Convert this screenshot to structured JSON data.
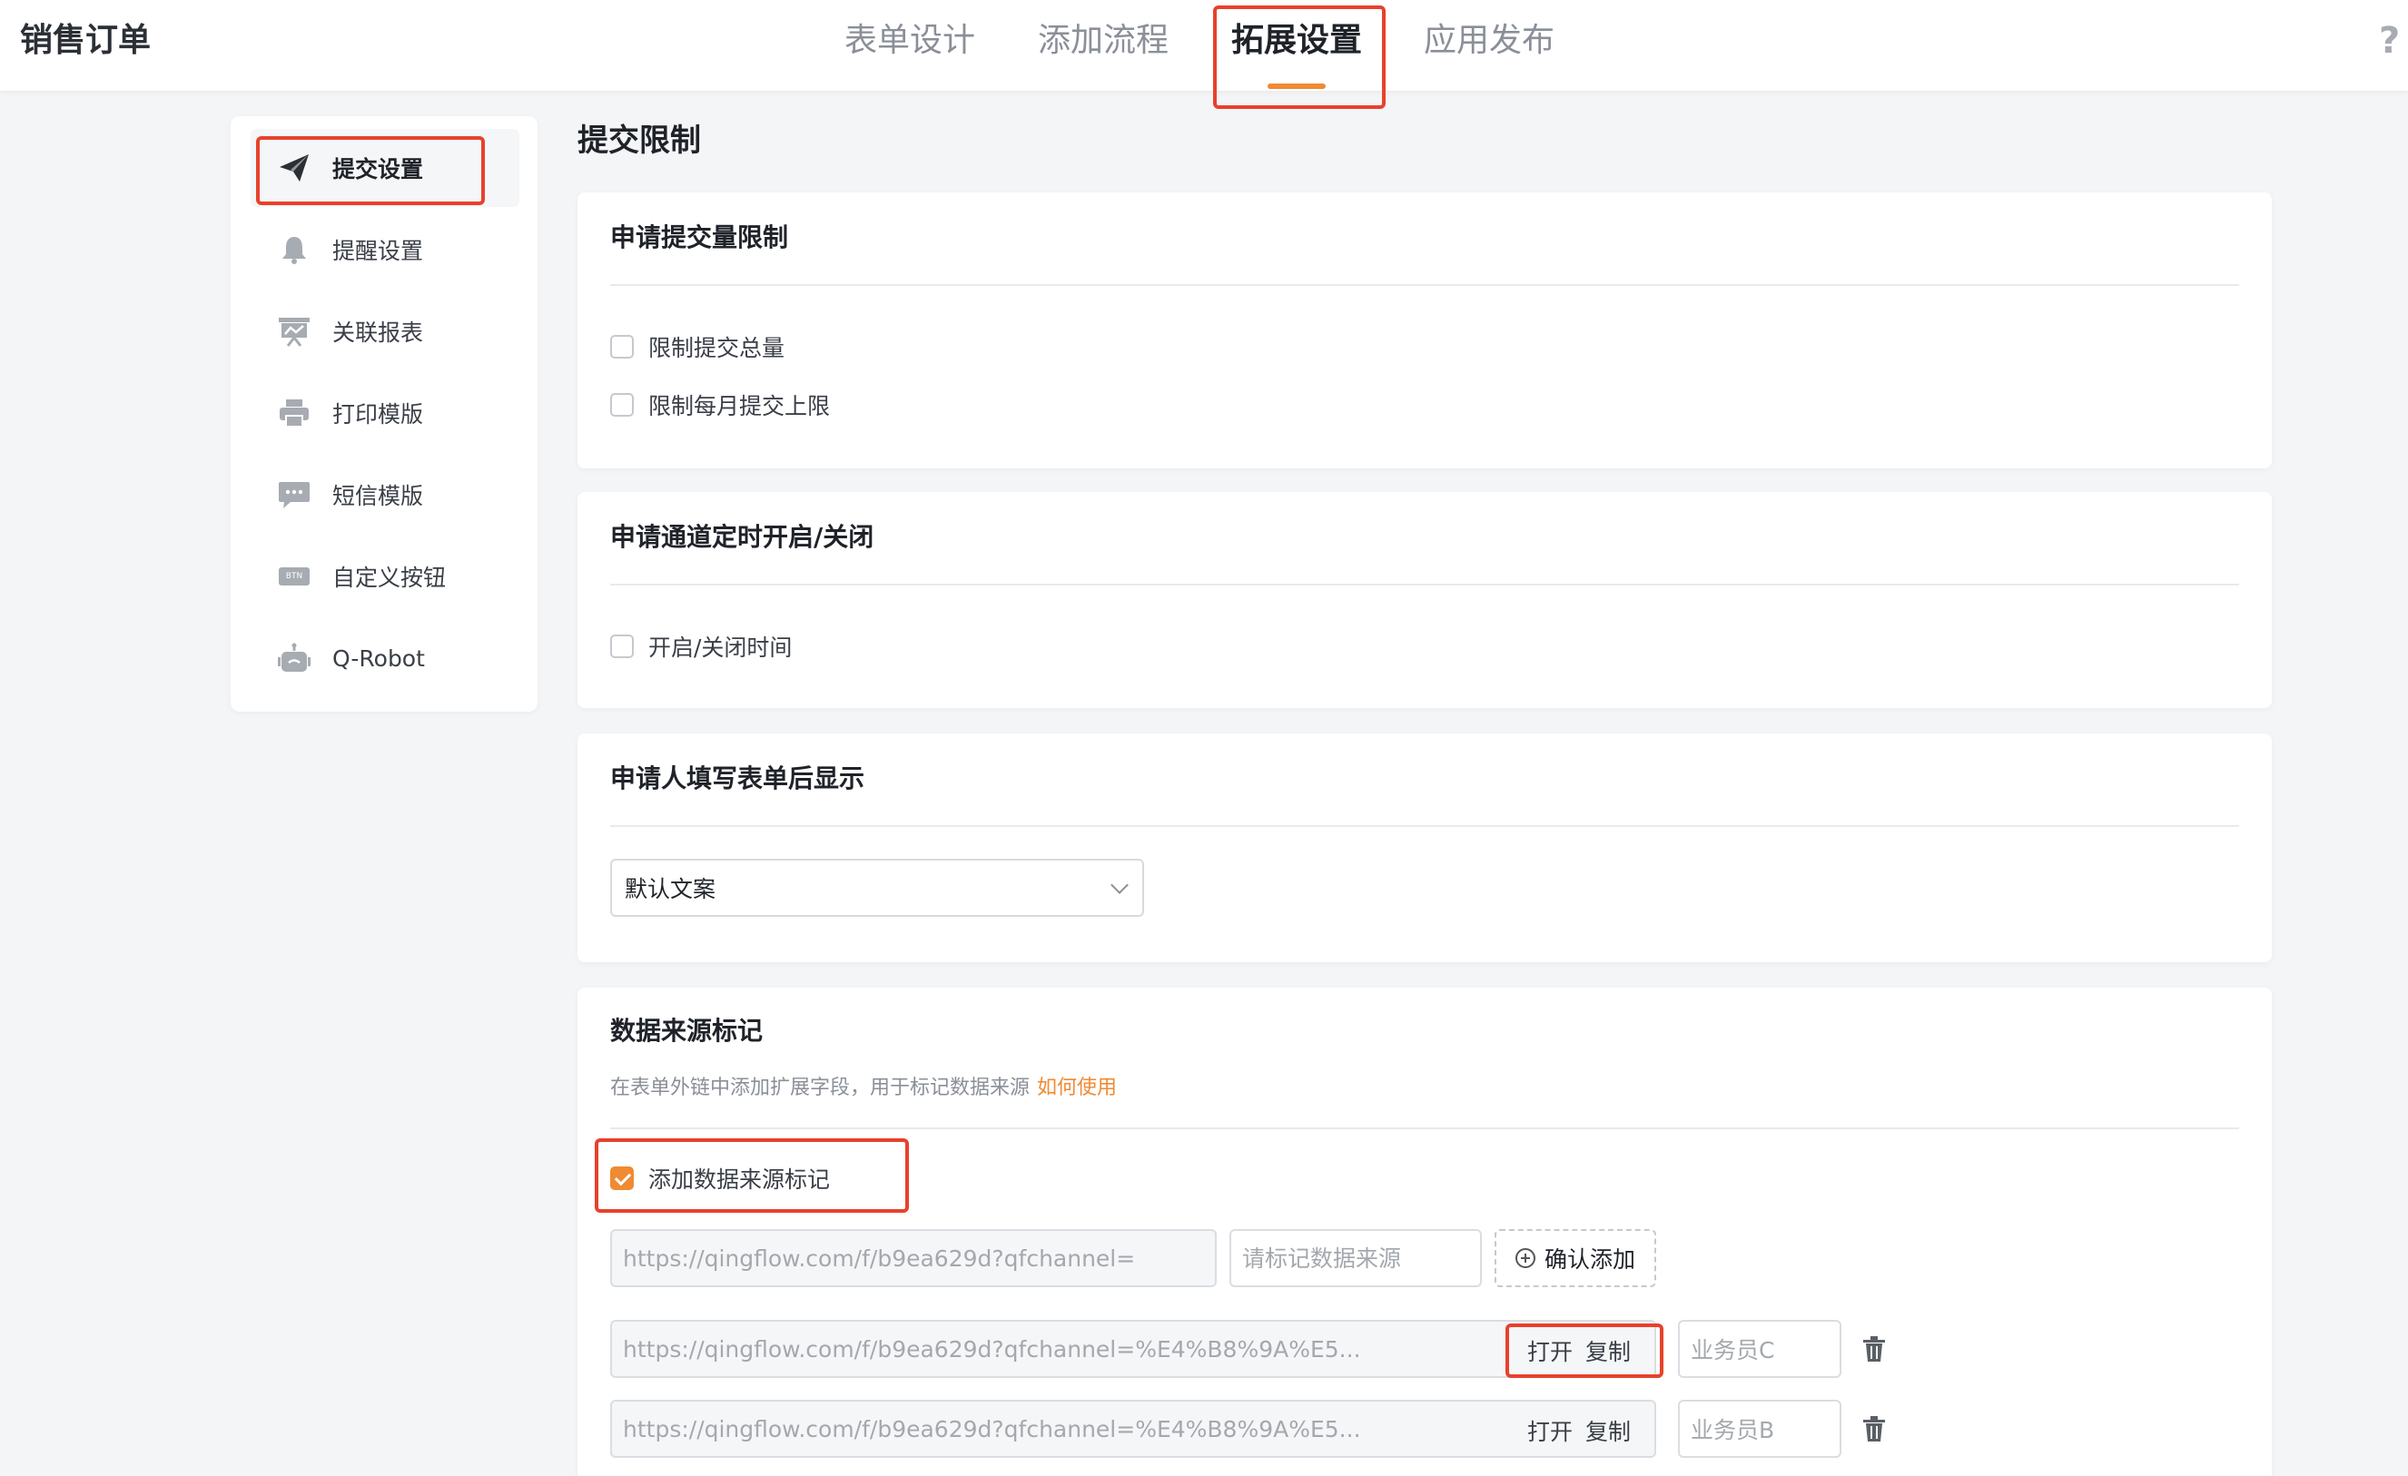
{
  "header": {
    "app_title": "销售订单",
    "tabs": [
      {
        "label": "表单设计"
      },
      {
        "label": "添加流程"
      },
      {
        "label": "拓展设置"
      },
      {
        "label": "应用发布"
      }
    ],
    "active_tab": "拓展设置",
    "help": "?"
  },
  "sidebar": {
    "items": [
      {
        "label": "提交设置",
        "icon": "paper-plane-icon"
      },
      {
        "label": "提醒设置",
        "icon": "bell-icon"
      },
      {
        "label": "关联报表",
        "icon": "report-board-icon"
      },
      {
        "label": "打印模版",
        "icon": "printer-icon"
      },
      {
        "label": "短信模版",
        "icon": "chat-bubble-icon"
      },
      {
        "label": "自定义按钮",
        "icon": "btn-badge-icon",
        "icon_text": "BTN"
      },
      {
        "label": "Q-Robot",
        "icon": "robot-icon"
      }
    ],
    "active_item": "提交设置"
  },
  "main": {
    "page_title": "提交限制",
    "submit_limit": {
      "title": "申请提交量限制",
      "options": [
        {
          "label": "限制提交总量",
          "checked": false
        },
        {
          "label": "限制每月提交上限",
          "checked": false
        }
      ]
    },
    "channel_schedule": {
      "title": "申请通道定时开启/关闭",
      "options": [
        {
          "label": "开启/关闭时间",
          "checked": false
        }
      ]
    },
    "after_submit": {
      "title": "申请人填写表单后显示",
      "select_value": "默认文案"
    },
    "data_source": {
      "title": "数据来源标记",
      "description": "在表单外链中添加扩展字段，用于标记数据来源",
      "help_link": "如何使用",
      "add_tag_checkbox": {
        "label": "添加数据来源标记",
        "checked": true
      },
      "base_url": "https://qingflow.com/f/b9ea629d?qfchannel=",
      "source_placeholder": "请标记数据来源",
      "confirm_add_label": "确认添加",
      "rows": [
        {
          "url": "https://qingflow.com/f/b9ea629d?qfchannel=%E4%B8%9A%E5...",
          "open_label": "打开",
          "copy_label": "复制",
          "source": "业务员C"
        },
        {
          "url": "https://qingflow.com/f/b9ea629d?qfchannel=%E4%B8%9A%E5...",
          "open_label": "打开",
          "copy_label": "复制",
          "source": "业务员B"
        }
      ]
    }
  },
  "colors": {
    "accent": "#f08a33",
    "highlight": "#e8412c",
    "background": "#f4f5f7"
  }
}
